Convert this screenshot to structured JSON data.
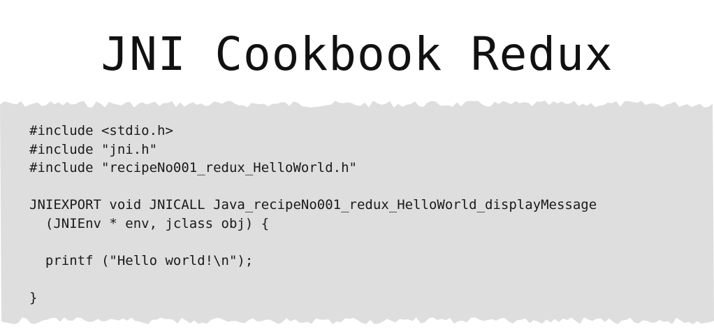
{
  "page": {
    "title": "JNI Cookbook Redux"
  },
  "code": {
    "lines": [
      "#include <stdio.h>",
      "#include \"jni.h\"",
      "#include \"recipeNo001_redux_HelloWorld.h\"",
      "",
      "JNIEXPORT void JNICALL Java_recipeNo001_redux_HelloWorld_displayMessage",
      "  (JNIEnv * env, jclass obj) {",
      "",
      "  printf (\"Hello world!\\n\");",
      "",
      "}"
    ]
  },
  "colors": {
    "background": "#ffffff",
    "paper": "#dedede",
    "text": "#1a1a1a"
  }
}
